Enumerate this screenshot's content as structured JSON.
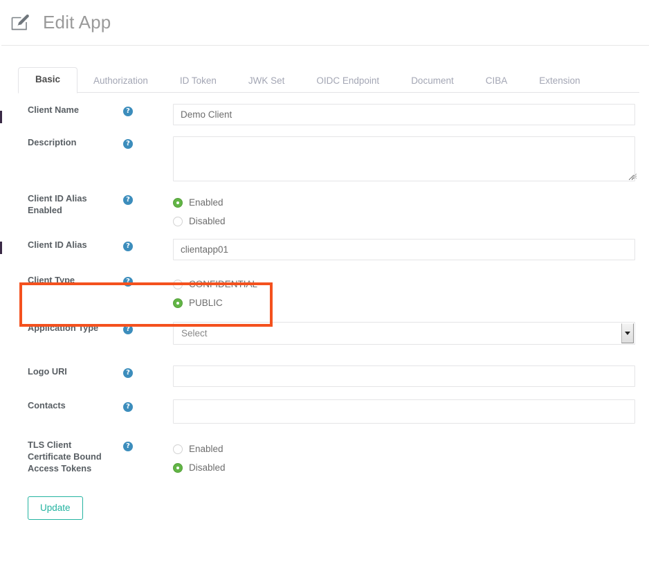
{
  "header": {
    "title": "Edit App",
    "icon": "edit-pencil-square-icon"
  },
  "tabs": [
    {
      "label": "Basic",
      "active": true
    },
    {
      "label": "Authorization",
      "active": false
    },
    {
      "label": "ID Token",
      "active": false
    },
    {
      "label": "JWK Set",
      "active": false
    },
    {
      "label": "OIDC Endpoint",
      "active": false
    },
    {
      "label": "Document",
      "active": false
    },
    {
      "label": "CIBA",
      "active": false
    },
    {
      "label": "Extension",
      "active": false
    }
  ],
  "help_icon_label": "?",
  "fields": {
    "client_name": {
      "label": "Client Name",
      "value": "Demo Client",
      "placeholder": ""
    },
    "description": {
      "label": "Description",
      "value": "",
      "placeholder": ""
    },
    "client_id_alias_enabled": {
      "label": "Client ID Alias Enabled",
      "options": [
        "Enabled",
        "Disabled"
      ],
      "selected": "Enabled"
    },
    "client_id_alias": {
      "label": "Client ID Alias",
      "value": "clientapp01",
      "placeholder": ""
    },
    "client_type": {
      "label": "Client Type",
      "options": [
        "CONFIDENTIAL",
        "PUBLIC"
      ],
      "selected": "PUBLIC",
      "highlighted": true
    },
    "application_type": {
      "label": "Application Type",
      "value": "Select",
      "options": [
        "Select"
      ]
    },
    "logo_uri": {
      "label": "Logo URI",
      "value": "",
      "placeholder": ""
    },
    "contacts": {
      "label": "Contacts",
      "value": "",
      "placeholder": ""
    },
    "tls_client_certificate_bound_access_tokens": {
      "label": "TLS Client Certificate Bound Access Tokens",
      "options": [
        "Enabled",
        "Disabled"
      ],
      "selected": "Disabled"
    }
  },
  "actions": {
    "update_label": "Update"
  },
  "colors": {
    "highlight": "#f4511e",
    "radio_on": "#62b546",
    "help_icon": "#3c8dbc",
    "accent_button": "#23b3a0",
    "title_text": "#9a9a9a"
  }
}
